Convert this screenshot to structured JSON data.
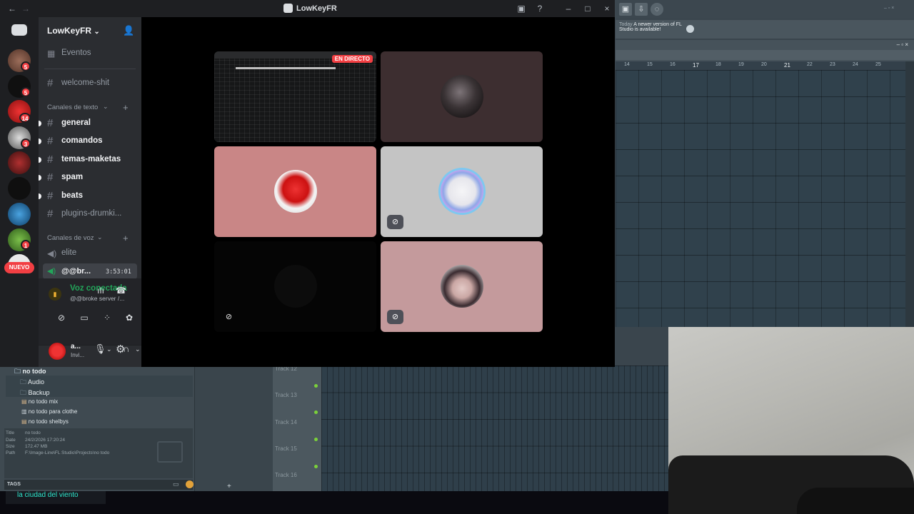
{
  "window": {
    "title": "LowKeyFR"
  },
  "server": {
    "name": "LowKeyFR"
  },
  "channels": {
    "events_label": "Eventos",
    "welcome": "welcome-shit",
    "text_category": "Canales de texto",
    "text_channels": [
      "general",
      "comandos",
      "temas-maketas",
      "spam",
      "beats",
      "plugins-drumki..."
    ],
    "voice_category": "Canales de voz",
    "voice_channels": [
      "elite"
    ],
    "active_voice": {
      "name": "@@br...",
      "timer": "3:53:01"
    }
  },
  "servers": {
    "badges": [
      "5",
      "5",
      "14",
      "3",
      "1"
    ],
    "new_label": "NUEVO"
  },
  "voice_panel": {
    "status": "Voz conectada",
    "server": "@@broke server /..."
  },
  "user": {
    "name": "a...",
    "status": "Invi..."
  },
  "call": {
    "live_badge": "EN DIRECTO"
  },
  "fl": {
    "hint_today": "Today",
    "hint_message": "A newer version of FL Studio is available!",
    "ruler": [
      "14",
      "15",
      "16",
      "17",
      "18",
      "19",
      "20",
      "21",
      "22",
      "23",
      "24",
      "25"
    ],
    "tracks": [
      "Track 12",
      "Track 13",
      "Track 14",
      "Track 15",
      "Track 16"
    ],
    "browser": {
      "root": "no todo",
      "folders": [
        "Audio",
        "Backup"
      ],
      "files": [
        "no todo mix",
        "no todo para clothe",
        "no todo shelbys"
      ]
    },
    "info": {
      "title_label": "Title",
      "title_value": "no todo",
      "date_label": "Date",
      "date_value": "24/2/2026 17:20:24",
      "size_label": "Size",
      "size_value": "172.47 MB",
      "path_label": "Path",
      "path_value": "F:\\Image-Line\\FL Studio\\Projects\\no todo"
    },
    "tags_label": "TAGS"
  },
  "taskbar": {
    "window_title": "la ciudad del viento"
  },
  "colors": {
    "discord_bg": "#2b2d31",
    "accent_green": "#23a55a",
    "badge_red": "#f23f43",
    "fl_grid": "#30414c"
  }
}
